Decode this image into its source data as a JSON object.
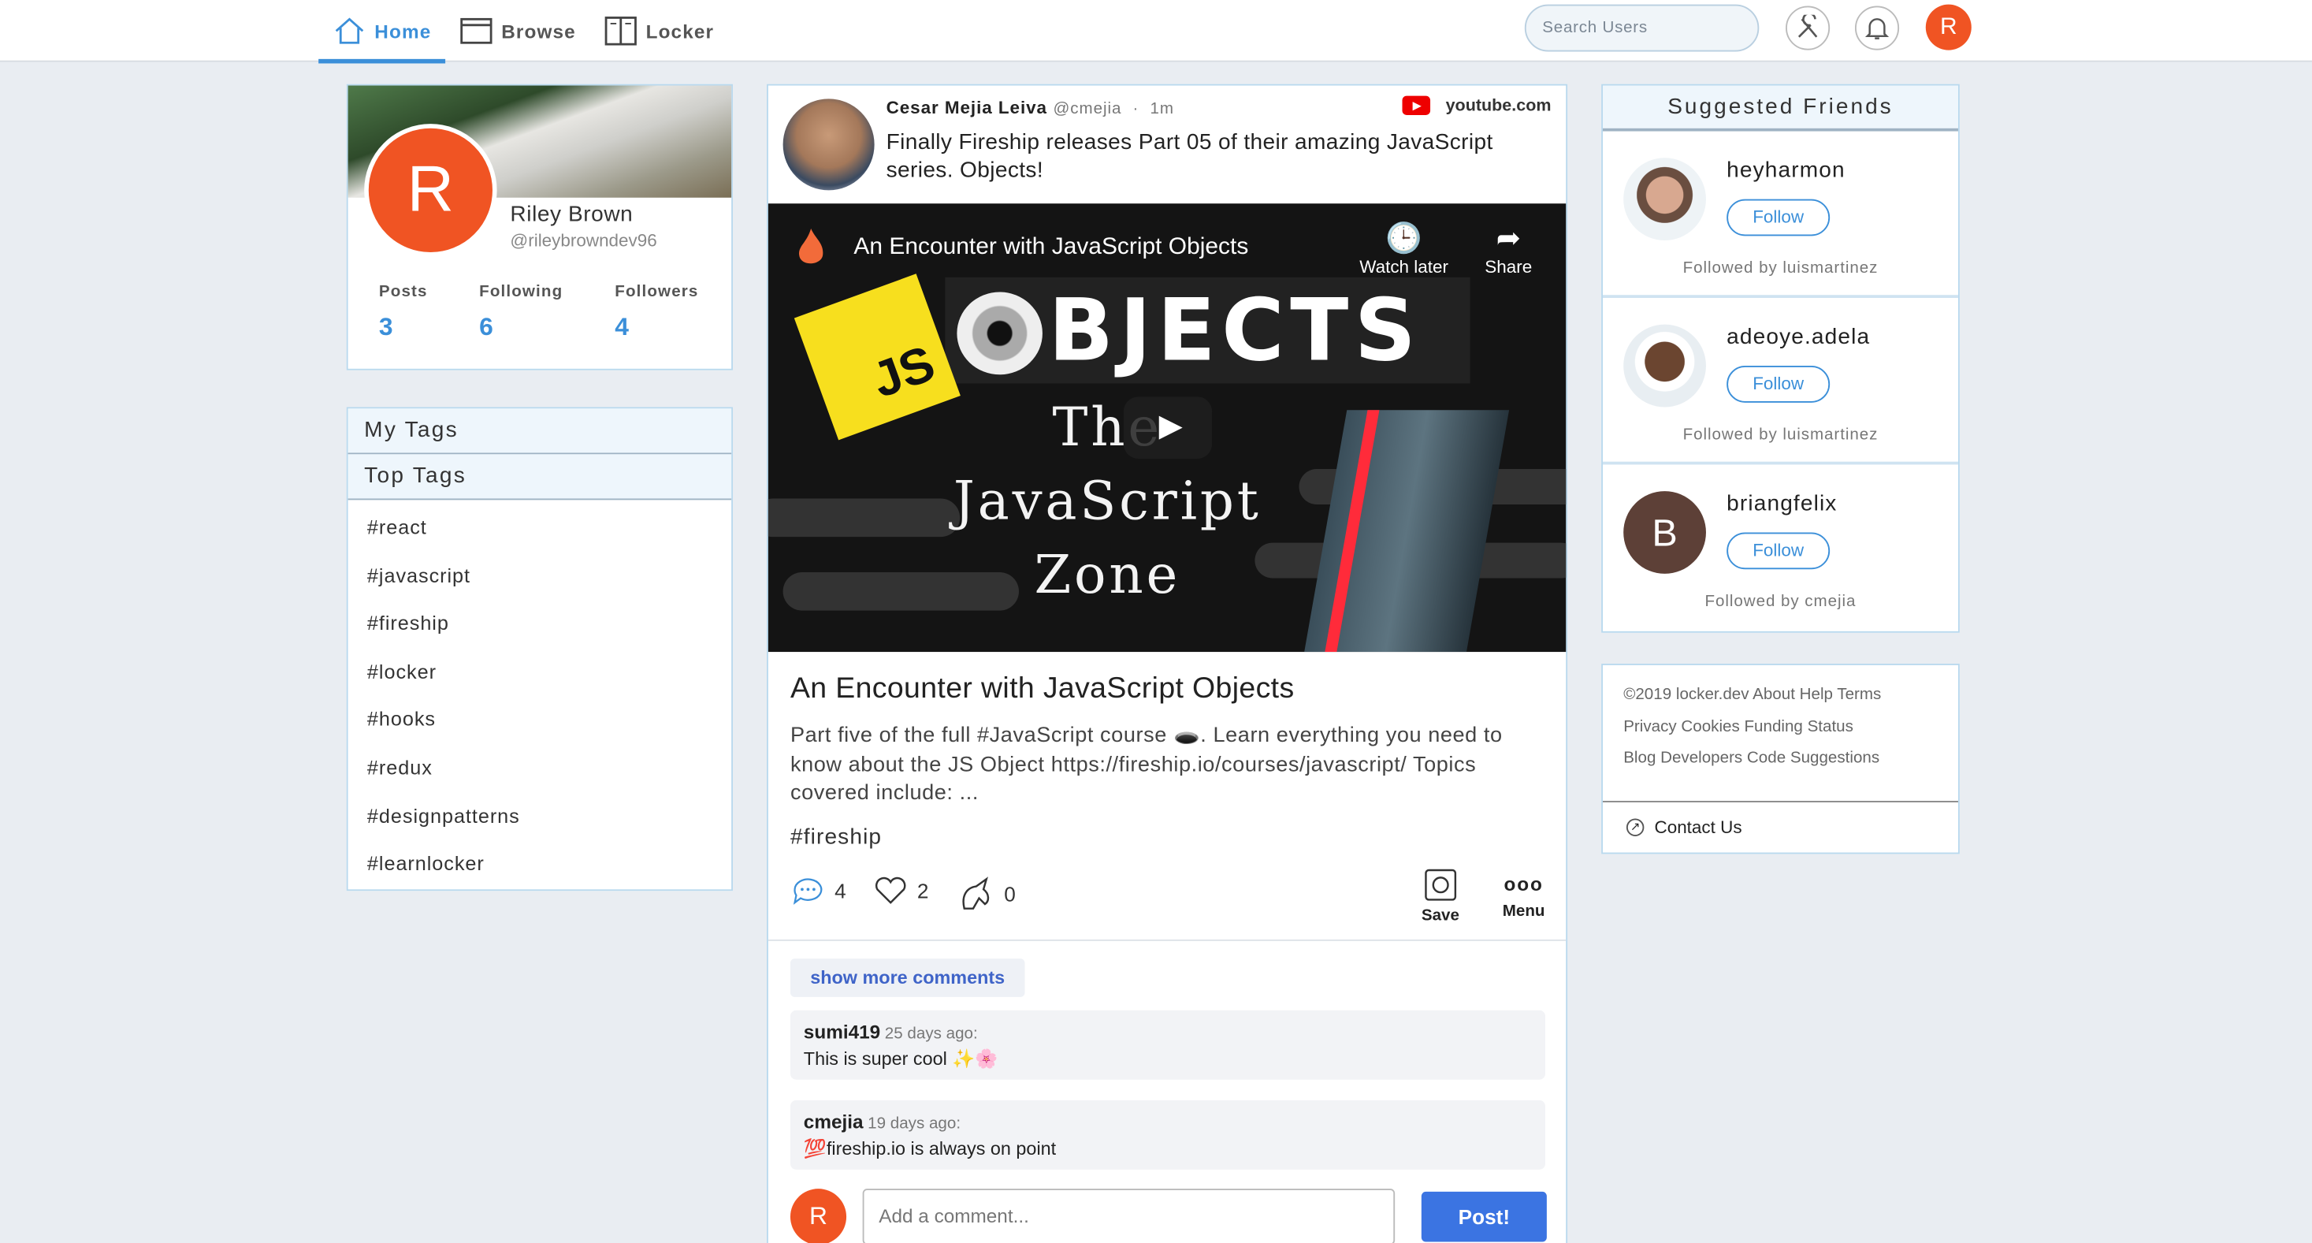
{
  "nav": {
    "items": [
      {
        "label": "Home",
        "icon": "home-icon",
        "active": true
      },
      {
        "label": "Browse",
        "icon": "browser-window-icon"
      },
      {
        "label": "Locker",
        "icon": "locker-icon"
      }
    ],
    "search_placeholder": "Search Users",
    "avatar_letter": "R",
    "accent": "#3b8fd9",
    "avatar_color": "#f05423"
  },
  "profile": {
    "avatar_letter": "R",
    "name": "Riley Brown",
    "handle": "@rileybrowndev96",
    "stats": [
      {
        "label": "Posts",
        "value": "3"
      },
      {
        "label": "Following",
        "value": "6"
      },
      {
        "label": "Followers",
        "value": "4"
      }
    ]
  },
  "tags": {
    "my_tags_title": "My Tags",
    "top_tags_title": "Top Tags",
    "items": [
      "#react",
      "#javascript",
      "#fireship",
      "#locker",
      "#hooks",
      "#redux",
      "#designpatterns",
      "#learnlocker"
    ]
  },
  "post": {
    "author": "Cesar Mejia Leiva",
    "handle": "@cmejia",
    "time": "1m",
    "source": "youtube.com",
    "text": "Finally Fireship releases Part 05 of their amazing JavaScript series. Objects!",
    "video": {
      "title": "An Encounter with JavaScript Objects",
      "watch_later": "Watch later",
      "share": "Share",
      "thumb_js": "JS",
      "thumb_objects": "BJECTS",
      "thumb_zone": "The JavaScript Zone"
    },
    "link_title": "An Encounter with JavaScript Objects",
    "link_desc": "Part five of the full #JavaScript course 🕳️. Learn everything you need to know about the JS Object https://fireship.io/courses/javascript/ Topics covered include: ...",
    "hashtag": "#fireship",
    "reactions": {
      "comments": "4",
      "likes": "2",
      "unicorns": "0"
    },
    "save_label": "Save",
    "menu_label": "Menu",
    "show_more": "show more comments",
    "comments": [
      {
        "user": "sumi419",
        "time": "25 days ago:",
        "text": "This is super cool ✨🌸"
      },
      {
        "user": "cmejia",
        "time": "19 days ago:",
        "text": "💯fireship.io is always on point"
      }
    ],
    "comment_avatar": "R",
    "comment_placeholder": "Add a comment...",
    "post_button": "Post!"
  },
  "suggested": {
    "title": "Suggested Friends",
    "follow_label": "Follow",
    "friends": [
      {
        "name": "heyharmon",
        "followed_by": "Followed by luismartinez"
      },
      {
        "name": "adeoye.adela",
        "followed_by": "Followed by luismartinez"
      },
      {
        "name": "briangfelix",
        "followed_by": "Followed by cmejia",
        "letter": "B"
      }
    ]
  },
  "footer": {
    "line1": "©2019 locker.dev About Help Terms",
    "line2": "Privacy Cookies Funding Status",
    "line3": "Blog Developers Code Suggestions",
    "contact": "Contact Us"
  }
}
